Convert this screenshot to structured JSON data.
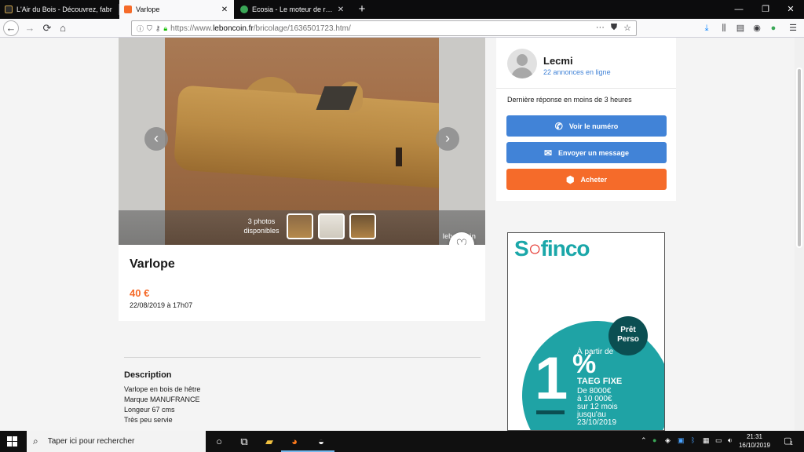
{
  "browser": {
    "tabs": [
      {
        "title": "L'Air du Bois - Découvrez, fabr",
        "active": false
      },
      {
        "title": "Varlope",
        "active": true
      },
      {
        "title": "Ecosia - Le moteur de recherch",
        "active": false
      }
    ],
    "new_tab": "+",
    "url": {
      "prefix": "https://www.",
      "host": "leboncoin.fr",
      "path": "/bricolage/1636501723.htm/"
    }
  },
  "gallery": {
    "photos_count": "3 photos\ndisponibles",
    "watermark": "leboncoin",
    "prev_icon": "chevron-left-icon",
    "next_icon": "chevron-right-icon"
  },
  "ad": {
    "title": "Varlope",
    "price": "40 €",
    "date": "22/08/2019 à 17h07"
  },
  "description": {
    "heading": "Description",
    "lines": [
      "Varlope en bois de hêtre",
      "Marque MANUFRANCE",
      "Longeur 67 cms",
      "Très peu servie"
    ]
  },
  "seller": {
    "name": "Lecmi",
    "ads_count": "22 annonces en ligne",
    "reply_time": "Dernière réponse en moins de 3 heures",
    "buttons": {
      "phone": "Voir le numéro",
      "message": "Envoyer un message",
      "buy": "Acheter"
    }
  },
  "banner": {
    "brand_a": "S",
    "brand_b": "finco",
    "badge_line1": "Prêt",
    "badge_line2": "Perso",
    "rate_big": "1",
    "rate_pct": "%",
    "line1": "À partir de",
    "line2": "TAEG FIXE",
    "line3": "De 8000€",
    "line4": "à 10 000€",
    "line5": "sur 12 mois",
    "line6": "jusqu'au",
    "line7": "23/10/2019"
  },
  "taskbar": {
    "search_placeholder": "Taper ici pour rechercher",
    "time": "21:31",
    "date": "16/10/2019",
    "notifications": "1"
  },
  "colors": {
    "accent_blue": "#4183d7",
    "accent_orange": "#f56b2a",
    "brand_teal": "#1fa3a5"
  }
}
